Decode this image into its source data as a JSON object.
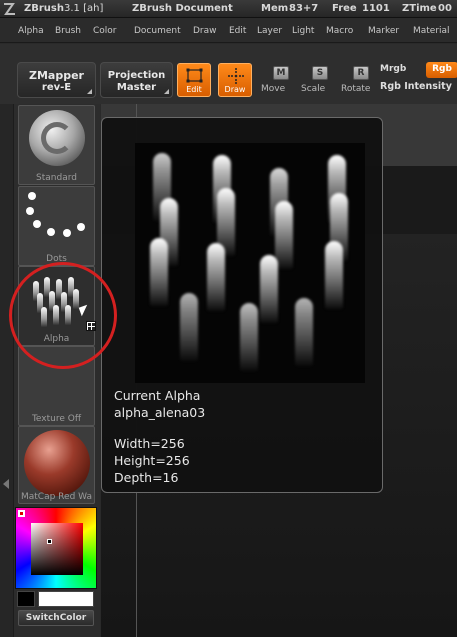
{
  "titlebar": {
    "app_name": "ZBrush",
    "version": "3.1 [ah]",
    "document": "ZBrush Document",
    "mem_label": "Mem",
    "mem_value": "83+7",
    "free_label": "Free",
    "free_value": "1101",
    "ztime_label": "ZTime",
    "ztime_value": "00"
  },
  "menu": [
    "Alpha",
    "Brush",
    "Color",
    "Document",
    "Draw",
    "Edit",
    "Layer",
    "Light",
    "Macro",
    "Marker",
    "Material"
  ],
  "toolbar": {
    "zmapper_l1": "ZMapper",
    "zmapper_l2": "rev-E",
    "projection_l1": "Projection",
    "projection_l2": "Master",
    "edit": "Edit",
    "draw": "Draw",
    "move_key": "M",
    "move": "Move",
    "scale_key": "S",
    "scale": "Scale",
    "rotate_key": "R",
    "rotate": "Rotate",
    "mrgb": "Mrgb",
    "rgb": "Rgb",
    "rgb_intensity": "Rgb Intensity"
  },
  "thumbs": {
    "standard": "Standard",
    "dots": "Dots",
    "alpha": "Alpha",
    "texture": "Texture Off",
    "matcap": "MatCap Red Wa"
  },
  "colors": {
    "accent": "#ff7a00",
    "annotation": "#d42020"
  },
  "switch_color": "SwitchColor",
  "popup": {
    "title": "Current Alpha",
    "name": "alpha_alena03",
    "width": "Width=256",
    "height": "Height=256",
    "depth": "Depth=16"
  }
}
